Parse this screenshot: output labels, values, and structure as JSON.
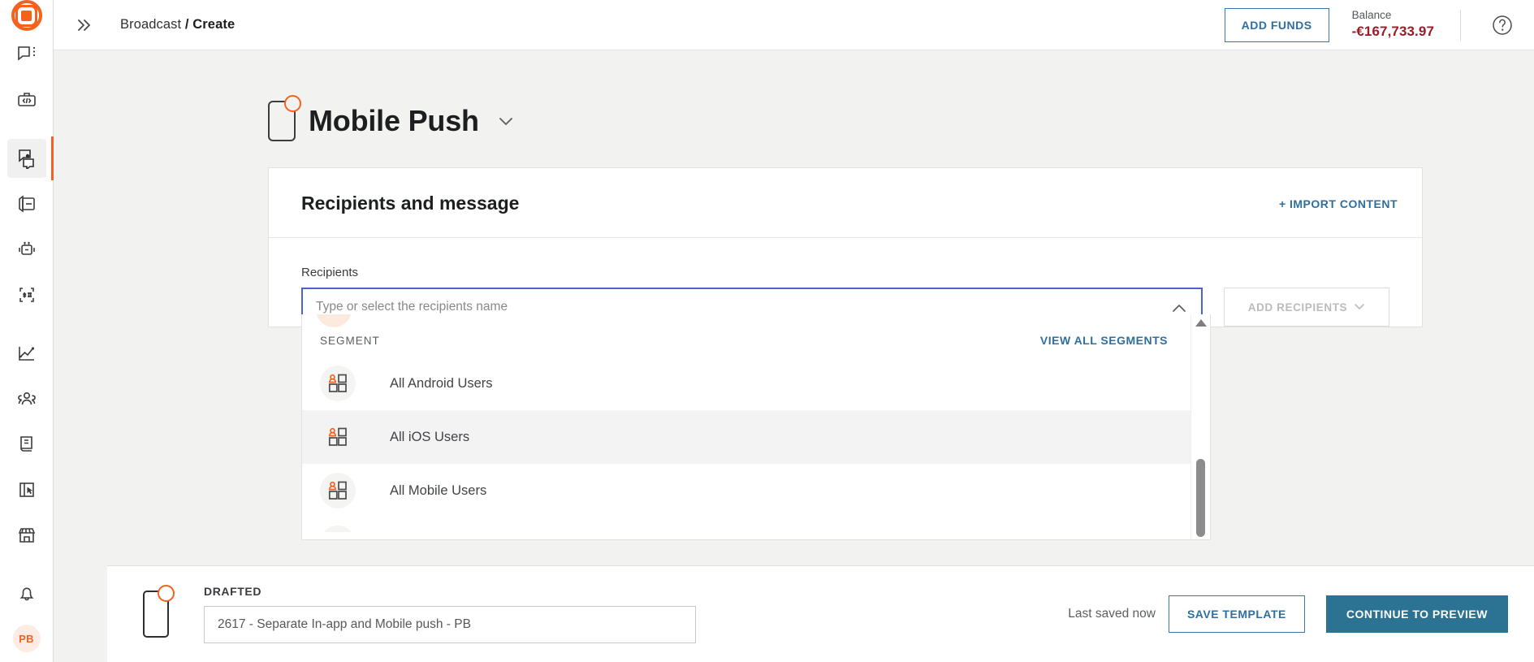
{
  "sidebar": {
    "logo": "logo-mark",
    "groups": [
      {
        "items": [
          {
            "name": "messages-icon",
            "active": false
          },
          {
            "name": "developer-toolkit-icon",
            "active": false
          }
        ]
      },
      {
        "items": [
          {
            "name": "broadcast-icon",
            "active": true
          },
          {
            "name": "transactional-icon",
            "active": false
          },
          {
            "name": "bot-icon",
            "active": false
          },
          {
            "name": "snippets-icon",
            "active": false
          }
        ]
      },
      {
        "items": [
          {
            "name": "analytics-icon",
            "active": false
          },
          {
            "name": "audience-icon",
            "active": false
          },
          {
            "name": "library-icon",
            "active": false
          },
          {
            "name": "journeys-icon",
            "active": false
          },
          {
            "name": "marketplace-icon",
            "active": false
          }
        ]
      }
    ],
    "bottom": {
      "notifications": "bell-icon",
      "avatar_initials": "PB"
    }
  },
  "topbar": {
    "expand_icon": "double-chevron-right-icon",
    "breadcrumb": {
      "parent": "Broadcast",
      "separator": "/",
      "current": "Create"
    },
    "add_funds_label": "ADD FUNDS",
    "balance_label": "Balance",
    "balance_value": "-€167,733.97",
    "balance_color": "#9b1c28",
    "help_icon": "question-circle-icon"
  },
  "page": {
    "icon": "mobile-push-icon",
    "title": "Mobile Push",
    "title_caret": "chevron-down-icon"
  },
  "card": {
    "title": "Recipients and message",
    "import_content_label": "+ IMPORT CONTENT",
    "recipients": {
      "label": "Recipients",
      "placeholder": "Type or select the recipients name",
      "value": "",
      "caret": "chevron-up-icon",
      "add_recipients_label": "ADD RECIPIENTS"
    },
    "dropdown": {
      "section_label": "SEGMENT",
      "view_all_label": "VIEW ALL SEGMENTS",
      "items": [
        {
          "label": "All Android Users",
          "hover": false
        },
        {
          "label": "All iOS Users",
          "hover": true
        },
        {
          "label": "All Mobile Users",
          "hover": false
        }
      ]
    }
  },
  "bottombar": {
    "icon": "mobile-push-icon",
    "status": "DRAFTED",
    "name_value": "2617 - Separate In-app and Mobile push - PB",
    "last_saved": "Last saved now",
    "save_template_label": "SAVE TEMPLATE",
    "continue_label": "CONTINUE TO PREVIEW",
    "primary_color": "#2b7293"
  },
  "colors": {
    "accent_orange": "#f5621e",
    "link_blue": "#2f6f9f",
    "focus_blue": "#4a63c8",
    "canvas": "#f2f2f0"
  }
}
